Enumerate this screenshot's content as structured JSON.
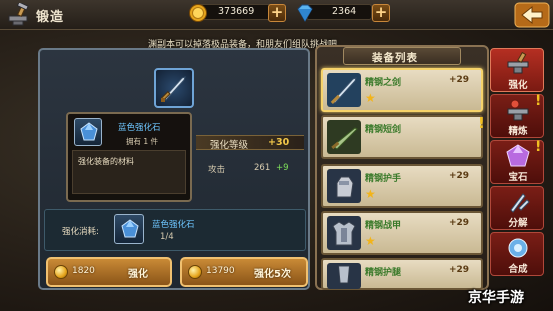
{
  "header": {
    "title": "锻造",
    "gold": "373669",
    "diamonds": "2364",
    "plus_symbol": "+",
    "icons": [
      "forge-icon",
      "gold-coin-icon",
      "diamond-icon",
      "back-arrow-icon"
    ]
  },
  "notice": "渊副本可以掉落极品装备，和朋友们组队挑战吧",
  "tooltip": {
    "item_name": "蓝色强化石",
    "owned": "拥有 1 件",
    "description": "强化装备的材料"
  },
  "stats": {
    "header_label": "强化等级",
    "header_value": "+30",
    "row_label": "攻击",
    "row_value": "261",
    "row_increase": "+9"
  },
  "material": {
    "label": "强化消耗:",
    "name": "蓝色强化石",
    "count": "1/4"
  },
  "actions": {
    "enhance": {
      "cost": "1820",
      "label": "强化"
    },
    "enhance5": {
      "cost": "13790",
      "label": "强化5次"
    }
  },
  "equipment_list": {
    "title": "装备列表",
    "items": [
      {
        "name": "精钢之剑",
        "level": "+29",
        "stars": "★",
        "alert": ""
      },
      {
        "name": "精钢短剑",
        "level": "",
        "stars": "",
        "alert": "!"
      },
      {
        "name": "精钢护手",
        "level": "+29",
        "stars": "★",
        "alert": ""
      },
      {
        "name": "精钢战甲",
        "level": "+29",
        "stars": "★",
        "alert": ""
      },
      {
        "name": "精钢护腿",
        "level": "+29",
        "stars": "",
        "alert": ""
      }
    ]
  },
  "side_tabs": [
    {
      "label": "强化",
      "icon": "anvil-icon",
      "alert": ""
    },
    {
      "label": "精炼",
      "icon": "refine-anvil-icon",
      "alert": "!"
    },
    {
      "label": "宝石",
      "icon": "gem-icon",
      "alert": "!"
    },
    {
      "label": "分解",
      "icon": "decompose-icon",
      "alert": ""
    },
    {
      "label": "合成",
      "icon": "synthesis-icon",
      "alert": ""
    }
  ],
  "watermark": "京华手游",
  "colors": {
    "accent_gold": "#f2c84a",
    "item_blue": "#6ec6ff",
    "tab_red": "#7a1e16",
    "increase_green": "#7ee05a"
  }
}
